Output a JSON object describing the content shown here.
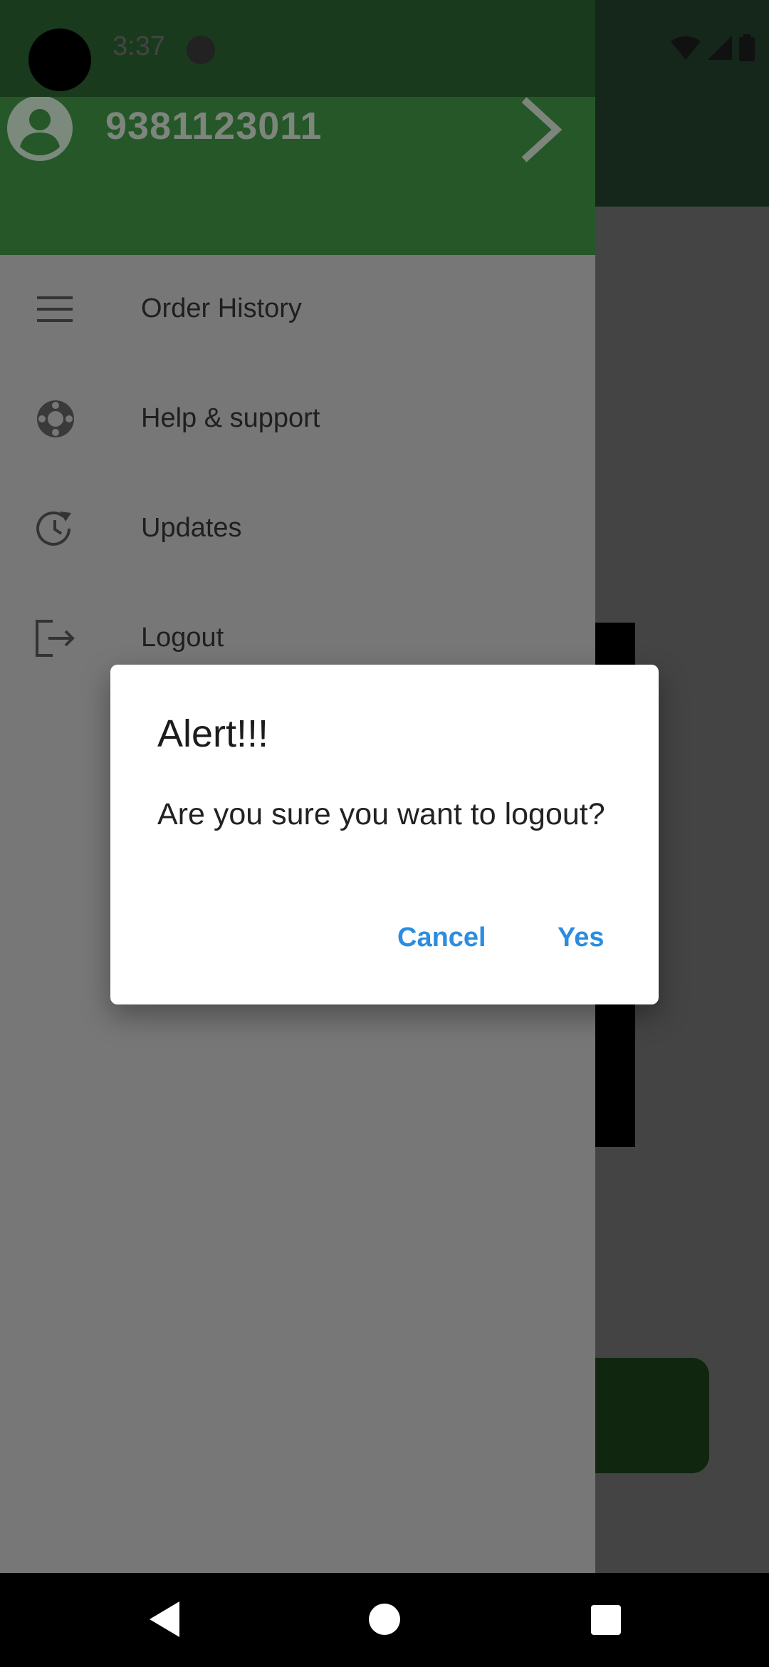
{
  "status_bar": {
    "time": "3:37",
    "icons": [
      "wifi-icon",
      "signal-icon",
      "battery-icon"
    ]
  },
  "drawer": {
    "header": {
      "phone": "9381123011",
      "avatar_icon": "account-circle-icon",
      "arrow_icon": "chevron-right-icon"
    },
    "items": [
      {
        "label": "Order History",
        "icon": "menu-lines-icon"
      },
      {
        "label": "Help & support",
        "icon": "lifebuoy-icon"
      },
      {
        "label": "Updates",
        "icon": "history-icon"
      },
      {
        "label": "Logout",
        "icon": "logout-icon"
      }
    ]
  },
  "dialog": {
    "title": "Alert!!!",
    "message": "Are you sure you want to logout?",
    "cancel_label": "Cancel",
    "yes_label": "Yes"
  },
  "colors": {
    "header_green": "#255728",
    "accent_blue": "#2b8de0",
    "drawer_bg": "#777777"
  }
}
